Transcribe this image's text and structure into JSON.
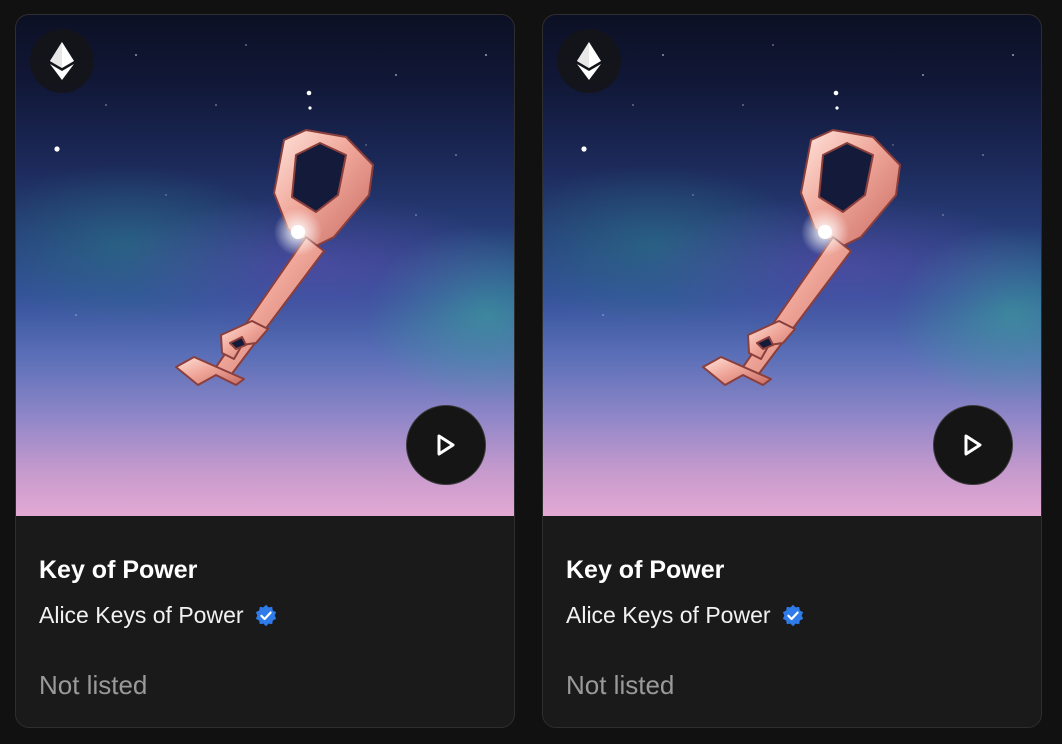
{
  "cards": [
    {
      "title": "Key of Power",
      "collection": "Alice Keys of Power",
      "verified": true,
      "status": "Not listed",
      "chain_icon": "ethereum-icon",
      "action_icon": "play-icon"
    },
    {
      "title": "Key of Power",
      "collection": "Alice Keys of Power",
      "verified": true,
      "status": "Not listed",
      "chain_icon": "ethereum-icon",
      "action_icon": "play-icon"
    }
  ],
  "colors": {
    "page_background": "#111111",
    "card_background": "#1a1a1a",
    "verified_blue": "#2f7bea",
    "muted_text": "#9a9a9a"
  }
}
